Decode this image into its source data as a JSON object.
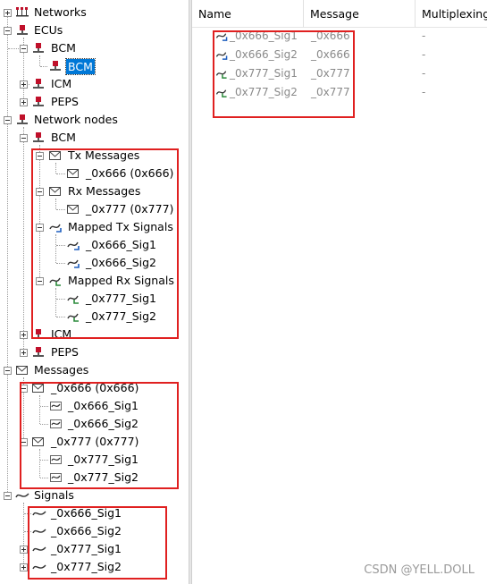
{
  "tree": {
    "networks": "Networks",
    "ecus": "ECUs",
    "ecu_bcm": "BCM",
    "ecu_bcm_child": "BCM",
    "ecu_icm": "ICM",
    "ecu_peps": "PEPS",
    "network_nodes": "Network nodes",
    "nn_bcm": "BCM",
    "tx_messages": "Tx Messages",
    "tx_msg_0": "_0x666 (0x666)",
    "rx_messages": "Rx Messages",
    "rx_msg_0": "_0x777 (0x777)",
    "mapped_tx": "Mapped Tx Signals",
    "mapped_tx_0": "_0x666_Sig1",
    "mapped_tx_1": "_0x666_Sig2",
    "mapped_rx": "Mapped Rx Signals",
    "mapped_rx_0": "_0x777_Sig1",
    "mapped_rx_1": "_0x777_Sig2",
    "nn_icm": "ICM",
    "nn_peps": "PEPS",
    "messages": "Messages",
    "msg_666": "_0x666 (0x666)",
    "msg_666_sig1": "_0x666_Sig1",
    "msg_666_sig2": "_0x666_Sig2",
    "msg_777": "_0x777 (0x777)",
    "msg_777_sig1": "_0x777_Sig1",
    "msg_777_sig2": "_0x777_Sig2",
    "signals": "Signals",
    "sig_0": "_0x666_Sig1",
    "sig_1": "_0x666_Sig2",
    "sig_2": "_0x777_Sig1",
    "sig_3": "_0x777_Sig2"
  },
  "list": {
    "columns": [
      "Name",
      "Message",
      "Multiplexing/"
    ],
    "rows": [
      {
        "name": "_0x666_Sig1",
        "message": "_0x666",
        "mux": "-"
      },
      {
        "name": "_0x666_Sig2",
        "message": "_0x666",
        "mux": "-"
      },
      {
        "name": "_0x777_Sig1",
        "message": "_0x777",
        "mux": "-"
      },
      {
        "name": "_0x777_Sig2",
        "message": "_0x777",
        "mux": "-"
      }
    ]
  },
  "watermark": "CSDN @YELL.DOLL",
  "colors": {
    "selection": "#0078d7",
    "highlight_box": "#e02020",
    "ecu_icon": "#c0102a"
  }
}
